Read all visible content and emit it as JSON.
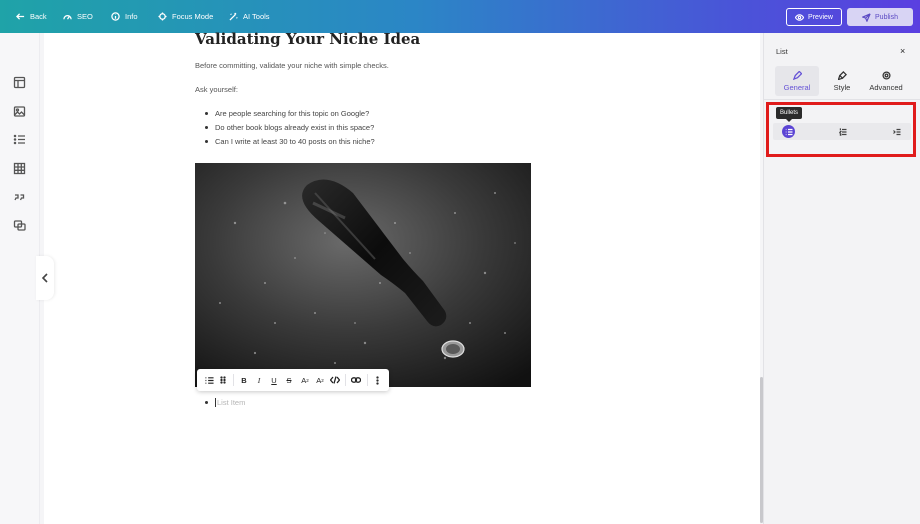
{
  "topbar": {
    "back": "Back",
    "seo": "SEO",
    "info": "Info",
    "focus_mode": "Focus Mode",
    "ai_tools": "AI Tools",
    "preview": "Preview",
    "publish": "Publish"
  },
  "left_toolbar": {
    "icons": [
      "layout-icon",
      "image-icon",
      "list-icon",
      "table-icon",
      "quote-icon",
      "embed-icon"
    ]
  },
  "article": {
    "heading": "Validating Your Niche Idea",
    "intro": "Before committing, validate your niche with simple checks.",
    "ask": "Ask yourself:",
    "bullets": [
      "Are people searching for this topic on Google?",
      "Do other book blogs already exist in this space?",
      "Can I write at least 30 to 40 posts on this niche?"
    ],
    "new_list_placeholder": "List Item"
  },
  "format_toolbar": {
    "bold": "B",
    "italic": "I",
    "underline": "U",
    "strike": "S",
    "superscript": "A",
    "subscript": "A"
  },
  "right_panel": {
    "title": "List",
    "close": "×",
    "tabs": [
      "General",
      "Style",
      "Advanced"
    ],
    "active_tab": "General",
    "tooltip": "Bullets",
    "style_options": [
      "bullets-icon",
      "numbered-icon",
      "indent-icon"
    ]
  },
  "colors": {
    "accent": "#5b44d4",
    "highlight": "#e01b1b"
  }
}
